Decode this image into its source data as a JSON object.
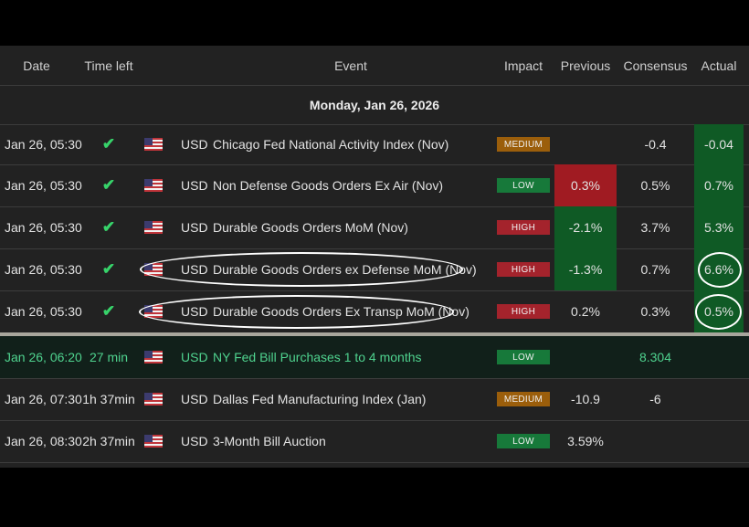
{
  "columns": {
    "date": "Date",
    "time_left": "Time left",
    "event": "Event",
    "impact": "Impact",
    "previous": "Previous",
    "consensus": "Consensus",
    "actual": "Actual"
  },
  "date_header": "Monday, Jan 26, 2026",
  "colors": {
    "background": "#222222",
    "high": "#a4232c",
    "medium": "#9b5e0b",
    "low": "#17793a",
    "beat": "#0f5a25",
    "miss": "#a01b22",
    "upcoming_text": "#4fd38f"
  },
  "rows": [
    {
      "date": "Jan 26, 05:30",
      "time_left_icon": "check-icon",
      "time_left_glyph": "✔",
      "time_left": "",
      "flag_icon": "us-flag-icon",
      "currency": "USD",
      "event": "Chicago Fed National Activity Index (Nov)",
      "impact": "MEDIUM",
      "previous": "",
      "consensus": "-0.4",
      "actual": "-0.04"
    },
    {
      "date": "Jan 26, 05:30",
      "time_left_icon": "check-icon",
      "time_left_glyph": "✔",
      "time_left": "",
      "flag_icon": "us-flag-icon",
      "currency": "USD",
      "event": "Non Defense Goods Orders Ex Air (Nov)",
      "impact": "LOW",
      "previous": "0.3%",
      "consensus": "0.5%",
      "actual": "0.7%"
    },
    {
      "date": "Jan 26, 05:30",
      "time_left_icon": "check-icon",
      "time_left_glyph": "✔",
      "time_left": "",
      "flag_icon": "us-flag-icon",
      "currency": "USD",
      "event": "Durable Goods Orders MoM (Nov)",
      "impact": "HIGH",
      "previous": "-2.1%",
      "consensus": "3.7%",
      "actual": "5.3%"
    },
    {
      "date": "Jan 26, 05:30",
      "time_left_icon": "check-icon",
      "time_left_glyph": "✔",
      "time_left": "",
      "flag_icon": "us-flag-icon",
      "currency": "USD",
      "event": "Durable Goods Orders ex Defense MoM (Nov)",
      "impact": "HIGH",
      "previous": "-1.3%",
      "consensus": "0.7%",
      "actual": "6.6%"
    },
    {
      "date": "Jan 26, 05:30",
      "time_left_icon": "check-icon",
      "time_left_glyph": "✔",
      "time_left": "",
      "flag_icon": "us-flag-icon",
      "currency": "USD",
      "event": "Durable Goods Orders Ex Transp MoM (Nov)",
      "impact": "HIGH",
      "previous": "0.2%",
      "consensus": "0.3%",
      "actual": "0.5%"
    },
    {
      "date": "Jan 26, 06:20",
      "time_left": "27 min",
      "flag_icon": "us-flag-icon",
      "currency": "USD",
      "event": "NY Fed Bill Purchases 1 to 4 months",
      "impact": "LOW",
      "previous": "",
      "consensus": "8.304",
      "actual": ""
    },
    {
      "date": "Jan 26, 07:30",
      "time_left": "1h 37min",
      "flag_icon": "us-flag-icon",
      "currency": "USD",
      "event": "Dallas Fed Manufacturing Index (Jan)",
      "impact": "MEDIUM",
      "previous": "-10.9",
      "consensus": "-6",
      "actual": ""
    },
    {
      "date": "Jan 26, 08:30",
      "time_left": "2h 37min",
      "flag_icon": "us-flag-icon",
      "currency": "USD",
      "event": "3-Month Bill Auction",
      "impact": "LOW",
      "previous": "3.59%",
      "consensus": "",
      "actual": ""
    }
  ]
}
